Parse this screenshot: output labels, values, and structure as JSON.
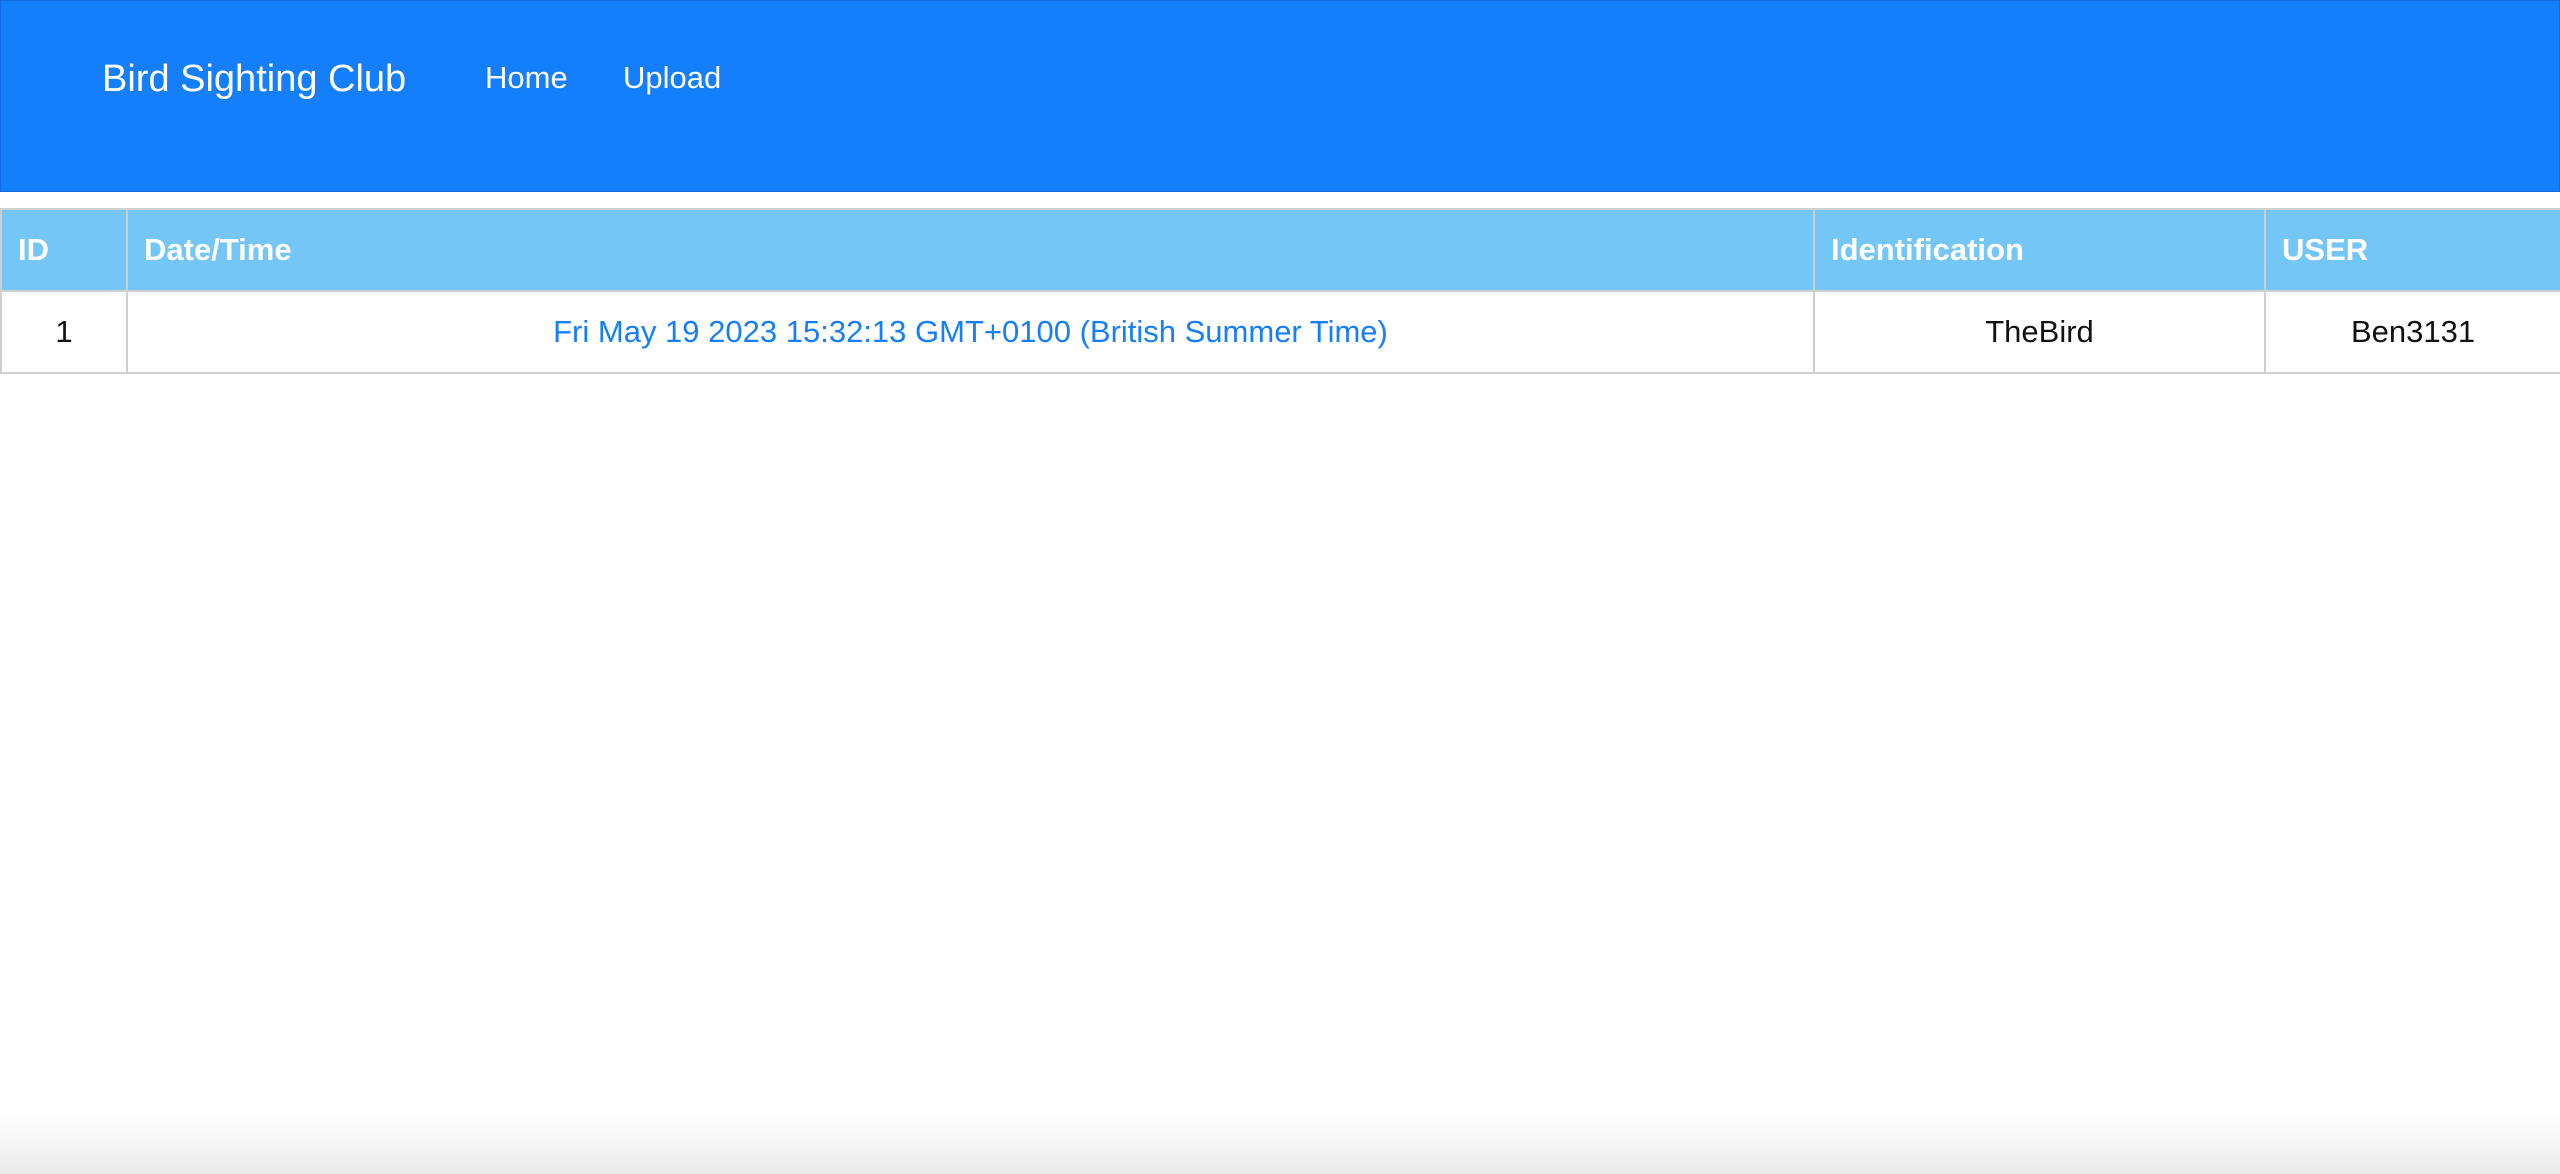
{
  "navbar": {
    "brand": "Bird Sighting Club",
    "links": [
      {
        "label": "Home"
      },
      {
        "label": "Upload"
      }
    ],
    "background_color": "#157efb"
  },
  "table": {
    "header_color": "#73c6f5",
    "link_color": "#157efb",
    "columns": [
      "ID",
      "Date/Time",
      "Identification",
      "USER"
    ],
    "rows": [
      {
        "id": "1",
        "datetime": "Fri May 19 2023 15:32:13 GMT+0100 (British Summer Time)",
        "identification": "TheBird",
        "user": "Ben3131"
      }
    ]
  }
}
